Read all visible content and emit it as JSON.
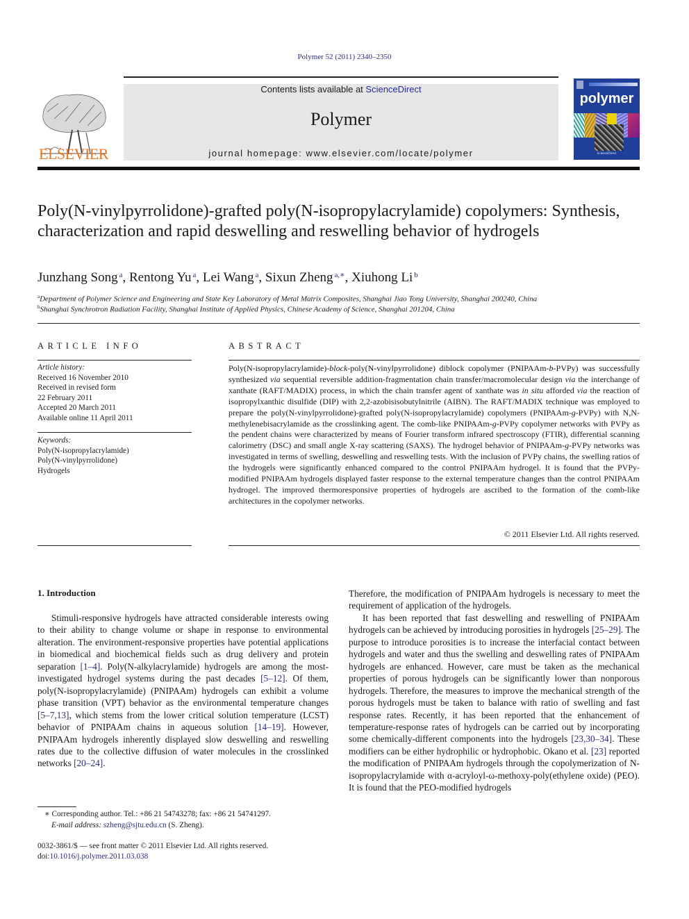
{
  "header": {
    "citation": "Polymer 52 (2011) 2340–2350",
    "contents_prefix": "Contents lists available at ",
    "contents_link": "ScienceDirect",
    "journal_name": "Polymer",
    "homepage": "journal homepage: www.elsevier.com/locate/polymer",
    "publisher_logo": "ELSEVIER",
    "cover_title": "polymer",
    "cover_footer": "ScienceDirect",
    "colors": {
      "publisher_orange": "#e87722",
      "cover_blue": "#1f3f99",
      "link_blue": "#2a2a7e",
      "band_gray": "#e6e6e6"
    }
  },
  "article": {
    "title": "Poly(N-vinylpyrrolidone)-grafted poly(N-isopropylacrylamide) copolymers: Synthesis, characterization and rapid deswelling and reswelling behavior of hydrogels",
    "authors": [
      {
        "name": "Junzhang Song",
        "aff": "a"
      },
      {
        "name": "Rentong Yu",
        "aff": "a"
      },
      {
        "name": "Lei Wang",
        "aff": "a"
      },
      {
        "name": "Sixun Zheng",
        "aff": "a,∗"
      },
      {
        "name": "Xiuhong Li",
        "aff": "b"
      }
    ],
    "affiliations": [
      {
        "mark": "a",
        "text": "Department of Polymer Science and Engineering and State Key Laboratory of Metal Matrix Composites, Shanghai Jiao Tong University, Shanghai 200240, China"
      },
      {
        "mark": "b",
        "text": "Shanghai Synchrotron Radiation Facility, Shanghai Institute of Applied Physics, Chinese Academy of Science, Shanghai 201204, China"
      }
    ]
  },
  "article_info": {
    "heading": "ARTICLE INFO",
    "history_label": "Article history:",
    "history": [
      "Received 16 November 2010",
      "Received in revised form",
      "22 February 2011",
      "Accepted 20 March 2011",
      "Available online 11 April 2011"
    ],
    "keywords_label": "Keywords:",
    "keywords": [
      "Poly(N-isopropylacrylamide)",
      "Poly(N-vinylpyrrolidone)",
      "Hydrogels"
    ]
  },
  "abstract": {
    "heading": "ABSTRACT",
    "parts": [
      {
        "t": "Poly(N-isopropylacrylamide)-"
      },
      {
        "t": "block",
        "i": true
      },
      {
        "t": "-poly(N-vinylpyrrolidone) diblock copolymer (PNIPAAm-"
      },
      {
        "t": "b",
        "i": true
      },
      {
        "t": "-PVPy) was successfully synthesized "
      },
      {
        "t": "via",
        "i": true
      },
      {
        "t": " sequential reversible addition-fragmentation chain transfer/macromolecular design "
      },
      {
        "t": "via",
        "i": true
      },
      {
        "t": " the interchange of xanthate (RAFT/MADIX) process, in which the chain transfer agent of xanthate was "
      },
      {
        "t": "in situ",
        "i": true
      },
      {
        "t": " afforded "
      },
      {
        "t": "via",
        "i": true
      },
      {
        "t": " the reaction of isopropylxanthic disulfide (DIP) with 2,2-azobisisobutylnitrile (AIBN). The RAFT/MADIX technique was employed to prepare the poly(N-vinylpyrrolidone)-grafted poly(N-isopropylacrylamide) copolymers (PNIPAAm-"
      },
      {
        "t": "g",
        "i": true
      },
      {
        "t": "-PVPy) with N,N-methylenebisacrylamide as the crosslinking agent. The comb-like PNIPAAm-"
      },
      {
        "t": "g",
        "i": true
      },
      {
        "t": "-PVPy copolymer networks with PVPy as the pendent chains were characterized by means of Fourier transform infrared spectroscopy (FTIR), differential scanning calorimetry (DSC) and small angle X-ray scattering (SAXS). The hydrogel behavior of PNIPAAm-"
      },
      {
        "t": "g",
        "i": true
      },
      {
        "t": "-PVPy networks was investigated in terms of swelling, deswelling and reswelling tests. With the inclusion of PVPy chains, the swelling ratios of the hydrogels were significantly enhanced compared to the control PNIPAAm hydrogel. It is found that the PVPy-modified PNIPAAm hydrogels displayed faster response to the external temperature changes than the control PNIPAAm hydrogel. The improved thermoresponsive properties of hydrogels are ascribed to the formation of the comb-like architectures in the copolymer networks."
      }
    ],
    "copyright": "© 2011 Elsevier Ltd. All rights reserved."
  },
  "body": {
    "section_heading": "1.  Introduction",
    "left_paragraphs": [
      [
        {
          "t": "Stimuli-responsive hydrogels have attracted considerable interests owing to their ability to change volume or shape in response to environmental alteration. The environment-responsive properties have potential applications in biomedical and biochemical fields such as drug delivery and protein separation "
        },
        {
          "t": "[1–4]",
          "ref": true
        },
        {
          "t": ". Poly(N-alkylacrylamide) hydrogels are among the most-investigated hydrogel systems during the past decades "
        },
        {
          "t": "[5–12]",
          "ref": true
        },
        {
          "t": ". Of them, poly(N-isopropylacrylamide) (PNIPAAm) hydrogels can exhibit a volume phase transition (VPT) behavior as the environmental temperature changes "
        },
        {
          "t": "[5–7,13]",
          "ref": true
        },
        {
          "t": ", which stems from the lower critical solution temperature (LCST) behavior of PNIPAAm chains in aqueous solution "
        },
        {
          "t": "[14–19]",
          "ref": true
        },
        {
          "t": ". However, PNIPAAm hydrogels inherently displayed slow deswelling and reswelling rates due to the collective diffusion of water molecules in the crosslinked networks "
        },
        {
          "t": "[20–24]",
          "ref": true
        },
        {
          "t": "."
        }
      ]
    ],
    "right_continuation": [
      {
        "t": "Therefore, the modification of PNIPAAm hydrogels is necessary to meet the requirement of application of the hydrogels."
      }
    ],
    "right_paragraphs": [
      [
        {
          "t": "It has been reported that fast deswelling and reswelling of PNIPAAm hydrogels can be achieved by introducing porosities in hydrogels "
        },
        {
          "t": "[25–29]",
          "ref": true
        },
        {
          "t": ". The purpose to introduce porosities is to increase the interfacial contact between hydrogels and water and thus the swelling and deswelling rates of PNIPAAm hydrogels are enhanced. However, care must be taken as the mechanical properties of porous hydrogels can be significantly lower than nonporous hydrogels. Therefore, the measures to improve the mechanical strength of the porous hydrogels must be taken to balance with ratio of swelling and fast response rates. Recently, it has been reported that the enhancement of temperature-response rates of hydrogels can be carried out by incorporating some chemically-different components into the hydrogels "
        },
        {
          "t": "[23,30–34]",
          "ref": true
        },
        {
          "t": ". These modifiers can be either hydrophilic or hydrophobic. Okano et al. "
        },
        {
          "t": "[23]",
          "ref": true
        },
        {
          "t": " reported the modification of PNIPAAm hydrogels through the copolymerization of N-isopropylacrylamide with α-acryloyl-ω-methoxy-poly(ethylene oxide) (PEO). It is found that the PEO-modified hydrogels"
        }
      ]
    ]
  },
  "footnotes": {
    "corresponding": "∗  Corresponding author. Tel.: +86 21 54743278; fax: +86 21 54741297.",
    "email_label": "E-mail address: ",
    "email": "szheng@sjtu.edu.cn",
    "email_suffix": " (S. Zheng).",
    "issn": "0032-3861/$ — see front matter © 2011 Elsevier Ltd. All rights reserved.",
    "doi_prefix": "doi:",
    "doi": "10.1016/j.polymer.2011.03.038"
  }
}
